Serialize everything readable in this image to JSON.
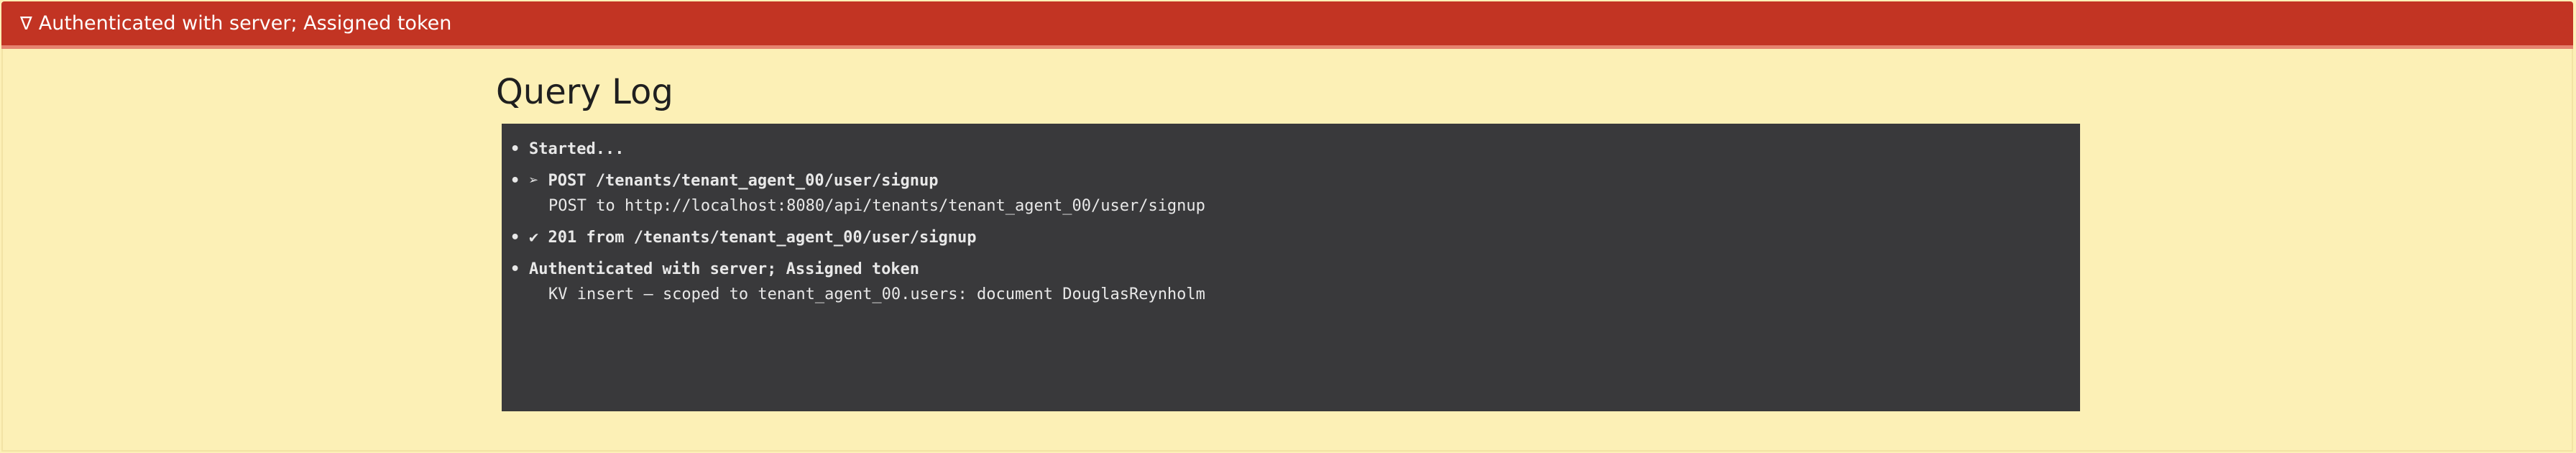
{
  "banner": {
    "icon": "triangle-down-icon",
    "icon_glyph": "∇",
    "text": "Authenticated with server; Assigned token"
  },
  "title": "Query Log",
  "log": {
    "bullet": "•",
    "entries": [
      {
        "head": "Started...",
        "details": []
      },
      {
        "head": "➢ POST /tenants/tenant_agent_00/user/signup",
        "details": [
          "POST to http://localhost:8080/api/tenants/tenant_agent_00/user/signup"
        ]
      },
      {
        "head": "✔ 201 from /tenants/tenant_agent_00/user/signup",
        "details": []
      },
      {
        "head": "Authenticated with server; Assigned token",
        "details": [
          "KV insert — scoped to tenant_agent_00.users: document DouglasReynholm"
        ]
      }
    ]
  }
}
